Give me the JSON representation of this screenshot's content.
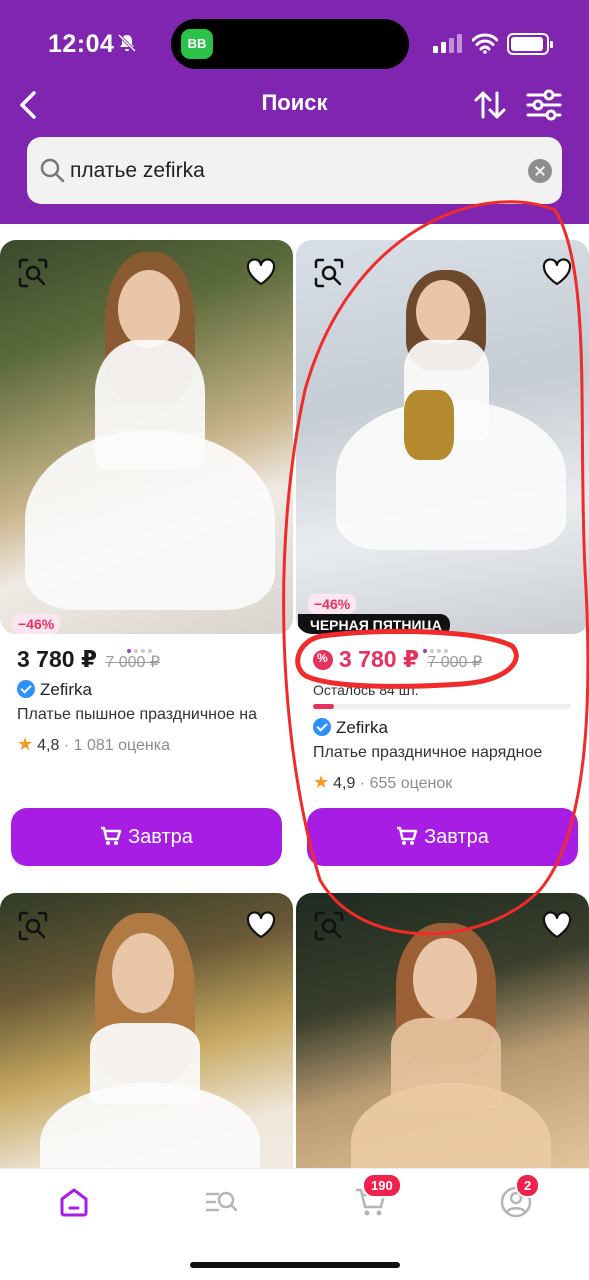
{
  "status_bar": {
    "time": "12:04",
    "app_badge": "BB"
  },
  "nav": {
    "title": "Поиск"
  },
  "search": {
    "query": "платье zefirka"
  },
  "products": [
    {
      "discount": "−46%",
      "price": "3 780 ₽",
      "old_price": "7 000 ₽",
      "brand": "Zefirka",
      "title": "Платье пышное праздничное на",
      "rating": "4,8",
      "rating_count": "· 1 081 оценка",
      "button": "Завтра"
    },
    {
      "discount": "−46%",
      "promo_label": "ЧЕРНАЯ ПЯТНИЦА",
      "price": "3 780 ₽",
      "old_price": "7 000 ₽",
      "stock": "Осталось 84 шт.",
      "brand": "Zefirka",
      "title": "Платье праздничное нарядное",
      "rating": "4,9",
      "rating_count": "· 655 оценок",
      "button": "Завтра"
    },
    {},
    {}
  ],
  "tabbar": {
    "cart_badge": "190",
    "profile_badge": "2"
  },
  "colors": {
    "header": "#7f25b0",
    "button": "#a81de3",
    "accent": "#e8305f"
  }
}
